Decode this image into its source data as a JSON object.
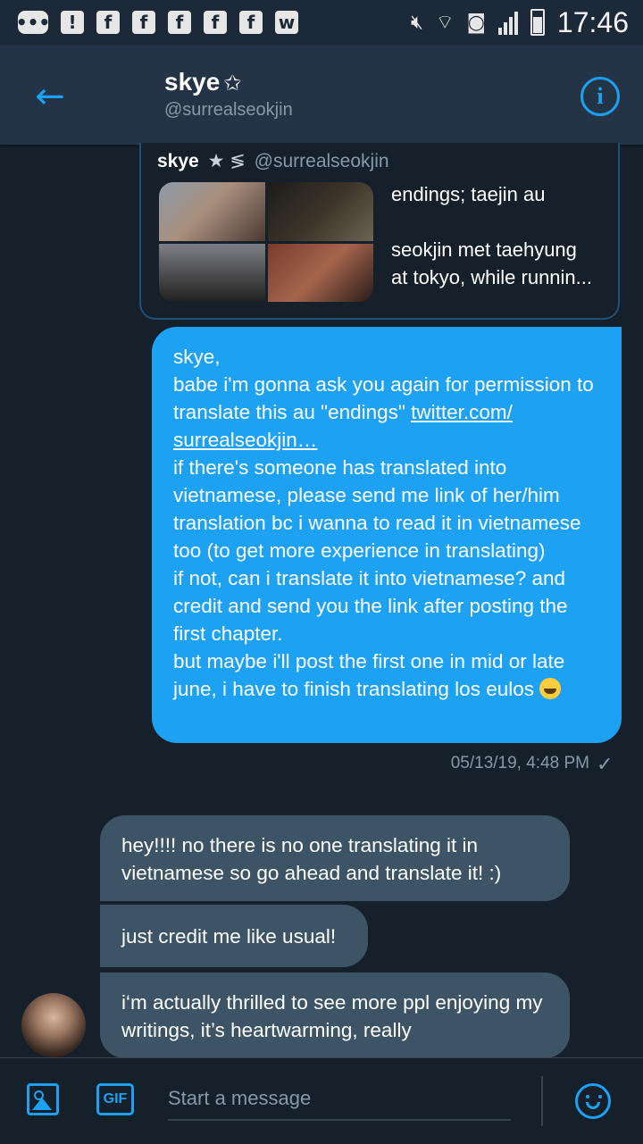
{
  "status_bar": {
    "time": "17:46",
    "notification_icons": [
      "messages-icon",
      "alert-icon",
      "facebook-icon",
      "facebook-icon",
      "facebook-icon",
      "facebook-icon",
      "facebook-icon",
      "wattpad-icon"
    ],
    "system_icons": [
      "mute-icon",
      "wifi-icon",
      "data-saver-icon",
      "signal-icon",
      "battery-icon"
    ]
  },
  "header": {
    "name": "skye",
    "star": "✩",
    "handle": "@surrealseokjin"
  },
  "quoted_tweet": {
    "name": "skye",
    "emojis": "★ ≶",
    "handle": "@surrealseokjin",
    "title": "endings; taejin au",
    "excerpt_line1": "seokjin met taehyung",
    "excerpt_line2": "at tokyo, while runnin..."
  },
  "sent_message": {
    "line_greeting": "skye,",
    "line_ask": "babe i'm gonna ask you again for permission to translate this au \"endings\" ",
    "link_text": "twitter.com/ surrealseokjin…",
    "line_someone": "if there's someone has translated into vietnamese, please send me link of her/him translation bc i wanna to read it in vietnamese too (to get more experience in translating)",
    "line_ifnot": "if not, can i translate it into vietnamese? and credit and send you the link after posting the first chapter.",
    "line_maybe": "but maybe i'll post the first one in mid or late june, i have to finish translating los eulos ",
    "timestamp": "05/13/19, 4:48 PM",
    "read_mark": "✓"
  },
  "received_messages": [
    {
      "text": "hey!!!! no there is no one translating it in vietnamese so go ahead and translate it! :)"
    },
    {
      "text": "just credit me like usual!"
    },
    {
      "text": "i‘m actually thrilled to see more ppl enjoying my writings, it’s heartwarming, really"
    }
  ],
  "composer": {
    "placeholder": "Start a message",
    "gif_label": "GIF"
  },
  "colors": {
    "background": "#15202b",
    "header": "#243447",
    "accent": "#1da1f2",
    "incoming_bubble": "#3d5466",
    "muted_text": "#8899a6"
  }
}
